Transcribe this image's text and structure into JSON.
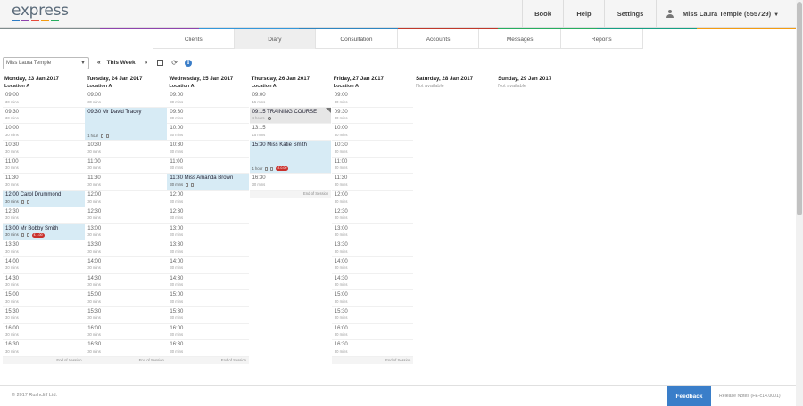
{
  "brand": {
    "logo_text": "express",
    "bar_colors": [
      "#2e7cc4",
      "#8e44ad",
      "#e74c3c",
      "#f39c12",
      "#27ae60"
    ]
  },
  "header": {
    "book_label": "Book",
    "help_label": "Help",
    "settings_label": "Settings",
    "user_label": "Miss Laura Temple (555729)",
    "rainbow_colors": [
      "#7f8c8d",
      "#8e44ad",
      "#3498db",
      "#2e86c1",
      "#c0392b",
      "#27ae60",
      "#16a085",
      "#f39c12"
    ]
  },
  "tabs": [
    {
      "label": "Clients"
    },
    {
      "label": "Diary"
    },
    {
      "label": "Consultation"
    },
    {
      "label": "Accounts"
    },
    {
      "label": "Messages"
    },
    {
      "label": "Reports"
    }
  ],
  "toolbar": {
    "practitioner": "Miss Laura Temple",
    "prev": "«",
    "week_label": "This Week",
    "next": "»",
    "info": "i"
  },
  "days": [
    {
      "name": "Monday, 23 Jan 2017",
      "location": "Location A",
      "slots": [
        {
          "time": "09:00",
          "dur": "30 mins"
        },
        {
          "time": "09:30",
          "dur": "30 mins"
        },
        {
          "time": "10:00",
          "dur": "30 mins"
        },
        {
          "time": "10:30",
          "dur": "30 mins"
        },
        {
          "time": "11:00",
          "dur": "30 mins"
        },
        {
          "time": "11:30",
          "dur": "30 mins"
        },
        {
          "time": "12:00 Carol Drummond",
          "dur": "30 mins",
          "booked": true
        },
        {
          "time": "12:30",
          "dur": "30 mins"
        },
        {
          "time": "13:00 Mr Bobby Smith",
          "dur": "30 mins",
          "booked": true,
          "badge": "£ 1.00"
        },
        {
          "time": "13:30",
          "dur": "30 mins"
        },
        {
          "time": "14:00",
          "dur": "30 mins"
        },
        {
          "time": "14:30",
          "dur": "30 mins"
        },
        {
          "time": "15:00",
          "dur": "30 mins"
        },
        {
          "time": "15:30",
          "dur": "30 mins"
        },
        {
          "time": "16:00",
          "dur": "30 mins"
        },
        {
          "time": "16:30",
          "dur": "30 mins"
        }
      ],
      "end": "End of Session"
    },
    {
      "name": "Tuesday, 24 Jan 2017",
      "location": "Location A",
      "slots": [
        {
          "time": "09:00",
          "dur": "30 mins"
        },
        {
          "time": "09:30 Mr David Tracey",
          "dur": "1 hour",
          "booked": true,
          "span": 2
        },
        {
          "time": "10:30",
          "dur": "30 mins"
        },
        {
          "time": "11:00",
          "dur": "30 mins"
        },
        {
          "time": "11:30",
          "dur": "30 mins"
        },
        {
          "time": "12:00",
          "dur": "30 mins"
        },
        {
          "time": "12:30",
          "dur": "30 mins"
        },
        {
          "time": "13:00",
          "dur": "30 mins"
        },
        {
          "time": "13:30",
          "dur": "30 mins"
        },
        {
          "time": "14:00",
          "dur": "30 mins"
        },
        {
          "time": "14:30",
          "dur": "30 mins"
        },
        {
          "time": "15:00",
          "dur": "30 mins"
        },
        {
          "time": "15:30",
          "dur": "30 mins"
        },
        {
          "time": "16:00",
          "dur": "30 mins"
        },
        {
          "time": "16:30",
          "dur": "30 mins"
        }
      ],
      "end": "End of Session"
    },
    {
      "name": "Wednesday, 25 Jan 2017",
      "location": "Location A",
      "slots": [
        {
          "time": "09:00",
          "dur": "30 mins"
        },
        {
          "time": "09:30",
          "dur": "30 mins"
        },
        {
          "time": "10:00",
          "dur": "30 mins"
        },
        {
          "time": "10:30",
          "dur": "30 mins"
        },
        {
          "time": "11:00",
          "dur": "30 mins"
        },
        {
          "time": "11:30 Miss Amanda Brown",
          "dur": "30 mins",
          "booked": true
        },
        {
          "time": "12:00",
          "dur": "30 mins"
        },
        {
          "time": "12:30",
          "dur": "30 mins"
        },
        {
          "time": "13:00",
          "dur": "30 mins"
        },
        {
          "time": "13:30",
          "dur": "30 mins"
        },
        {
          "time": "14:00",
          "dur": "30 mins"
        },
        {
          "time": "14:30",
          "dur": "30 mins"
        },
        {
          "time": "15:00",
          "dur": "30 mins"
        },
        {
          "time": "15:30",
          "dur": "30 mins"
        },
        {
          "time": "16:00",
          "dur": "30 mins"
        },
        {
          "time": "16:30",
          "dur": "30 mins"
        }
      ],
      "end": "End of Session"
    },
    {
      "name": "Thursday, 26 Jan 2017",
      "location": "Location A",
      "slots": [
        {
          "time": "09:00",
          "dur": "15 mins"
        },
        {
          "time": "09:15 TRAINING COURSE",
          "dur": "4 hours",
          "training": true
        },
        {
          "time": "13:15",
          "dur": "15 mins"
        },
        {
          "time": "15:30 Miss Katie Smith",
          "dur": "1 hour",
          "booked": true,
          "span": 2,
          "badge": "£ 0.00"
        },
        {
          "time": "16:30",
          "dur": "30 mins"
        }
      ],
      "end": "End of Session"
    },
    {
      "name": "Friday, 27 Jan 2017",
      "location": "Location A",
      "slots": [
        {
          "time": "09:00",
          "dur": "30 mins"
        },
        {
          "time": "09:30",
          "dur": "30 mins"
        },
        {
          "time": "10:00",
          "dur": "30 mins"
        },
        {
          "time": "10:30",
          "dur": "30 mins"
        },
        {
          "time": "11:00",
          "dur": "30 mins"
        },
        {
          "time": "11:30",
          "dur": "30 mins"
        },
        {
          "time": "12:00",
          "dur": "30 mins"
        },
        {
          "time": "12:30",
          "dur": "30 mins"
        },
        {
          "time": "13:00",
          "dur": "30 mins"
        },
        {
          "time": "13:30",
          "dur": "30 mins"
        },
        {
          "time": "14:00",
          "dur": "30 mins"
        },
        {
          "time": "14:30",
          "dur": "30 mins"
        },
        {
          "time": "15:00",
          "dur": "30 mins"
        },
        {
          "time": "15:30",
          "dur": "30 mins"
        },
        {
          "time": "16:00",
          "dur": "30 mins"
        },
        {
          "time": "16:30",
          "dur": "30 mins"
        }
      ],
      "end": "End of Session"
    },
    {
      "name": "Saturday, 28 Jan 2017",
      "unavailable": "Not available"
    },
    {
      "name": "Sunday, 29 Jan 2017",
      "unavailable": "Not available"
    }
  ],
  "footer": {
    "copyright": "© 2017 Rushcliff Ltd.",
    "feedback_label": "Feedback",
    "release": "Release Notes (FE-c14.0001)"
  }
}
